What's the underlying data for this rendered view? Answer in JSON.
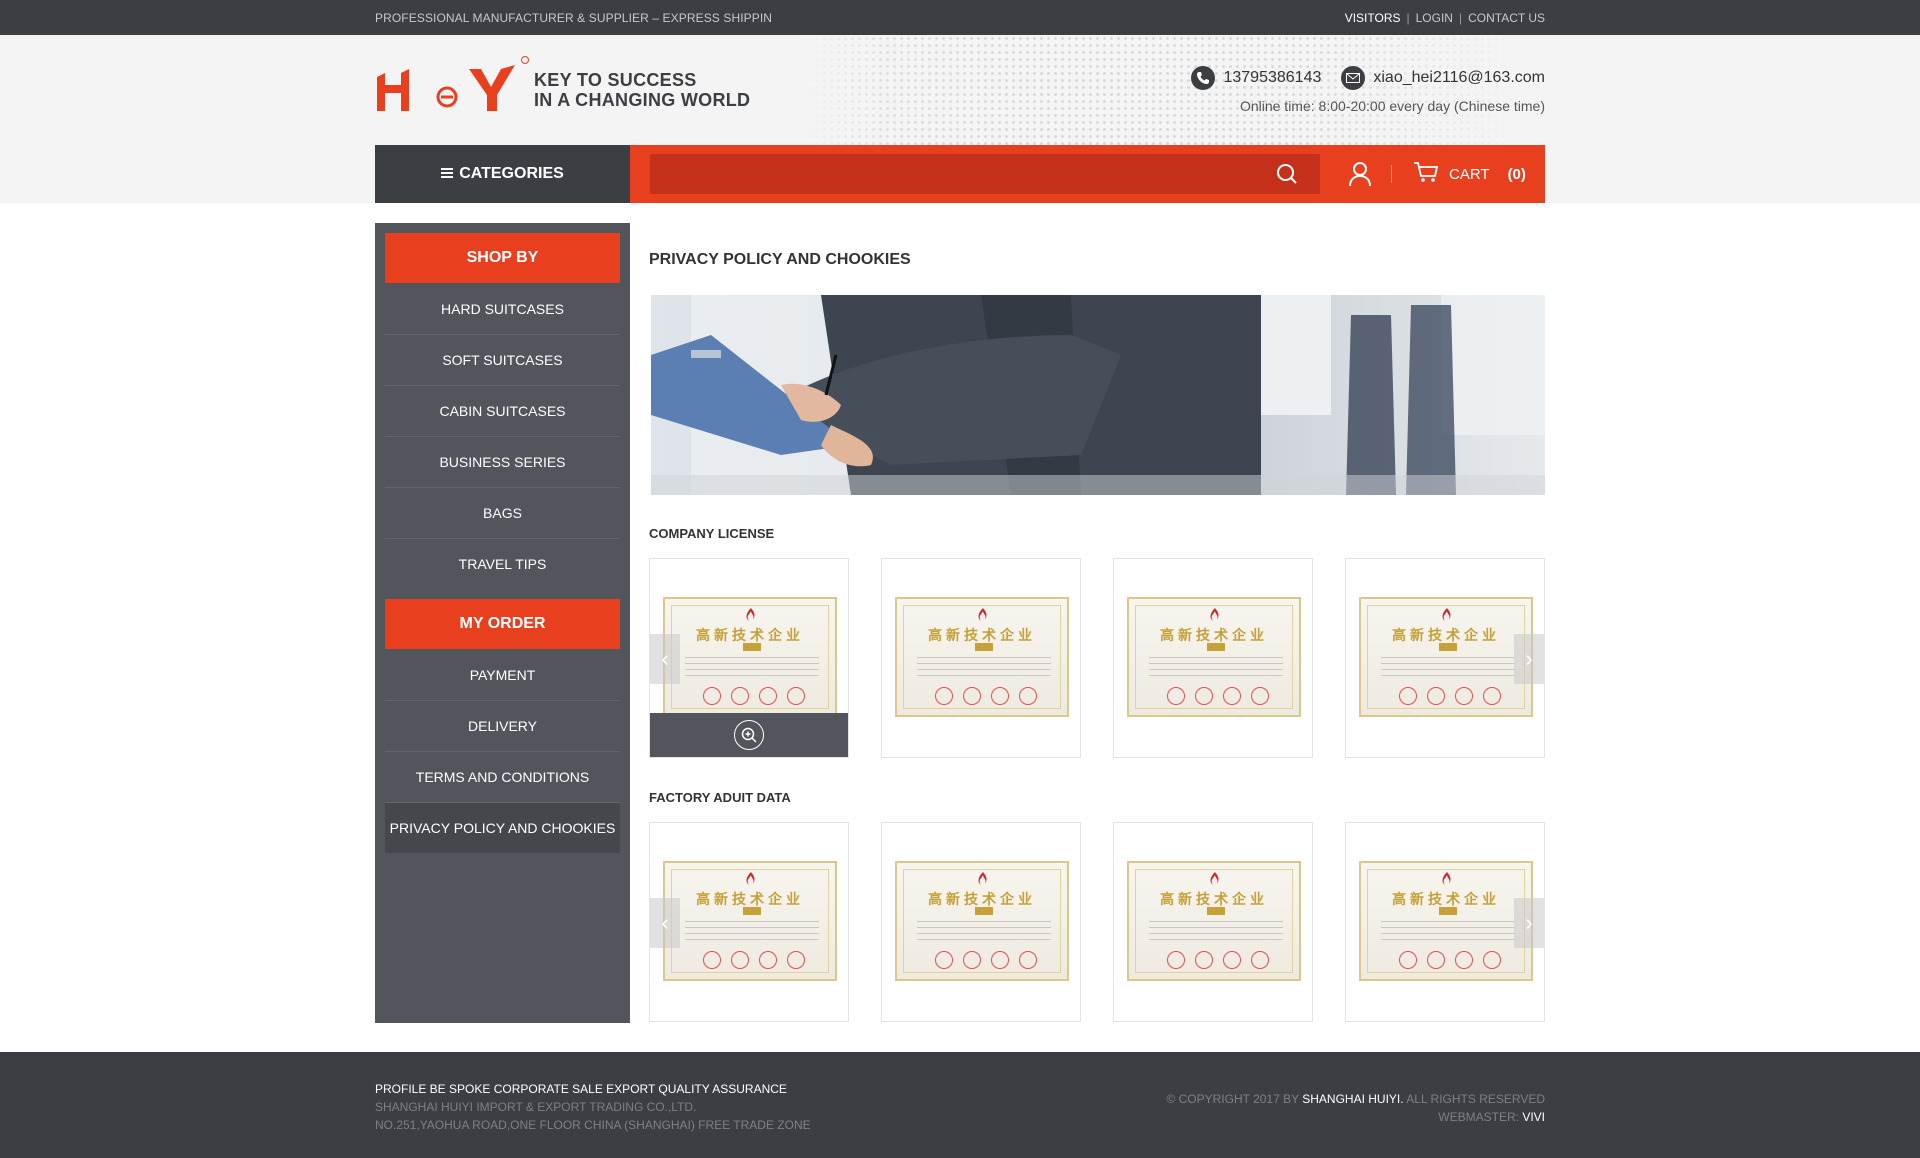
{
  "topbar": {
    "tagline": "PROFESSIONAL MANUFACTURER & SUPPLIER – EXPRESS SHIPPIN",
    "links": [
      "VISITORS",
      "LOGIN",
      "CONTACT US"
    ],
    "separator": "|"
  },
  "header": {
    "logo_alt": "H&Y",
    "slogan_line1": "KEY TO SUCCESS",
    "slogan_line2": "IN A CHANGING WORLD",
    "phone": "13795386143",
    "email": "xiao_hei2116@163.com",
    "online_time": "Online time: 8:00-20:00 every day (Chinese time)"
  },
  "nav": {
    "categories_label": "CATEGORIES",
    "search_placeholder": "",
    "cart_label": "CART",
    "cart_count": "(0)"
  },
  "sidebar": {
    "shop_by": "SHOP BY",
    "shop_items": [
      "HARD SUITCASES",
      "SOFT SUITCASES",
      "CABIN SUITCASES",
      "BUSINESS SERIES",
      "BAGS",
      "TRAVEL TIPS"
    ],
    "my_order": "MY ORDER",
    "order_items": [
      "PAYMENT",
      "DELIVERY",
      "TERMS AND CONDITIONS",
      "PRIVACY POLICY AND CHOOKIES"
    ]
  },
  "main": {
    "page_title": "PRIVACY POLICY AND CHOOKIES",
    "section1_title": "COMPANY LICENSE",
    "section2_title": "FACTORY ADUIT DATA",
    "certificate_text": "高新技术企业"
  },
  "footer": {
    "links_line": "PROFILE BE SPOKE CORPORATE SALE EXPORT QUALITY ASSURANCE",
    "company": "SHANGHAI HUIYI IMPORT & EXPORT  TRADING CO.,LTD.",
    "address": "NO.251,YAOHUA ROAD,ONE FLOOR  CHINA (SHANGHAI) FREE TRADE ZONE",
    "copyright_prefix": "© COPYRIGHT 2017 BY",
    "copyright_name": "SHANGHAI HUIYI.",
    "copyright_suffix": "ALL RIGHTS RESERVED",
    "webmaster_label": "WEBMASTER:",
    "webmaster_name": "VIVI"
  },
  "colors": {
    "accent": "#e8401f",
    "dark": "#3b3e43",
    "sidebar": "#52565c"
  }
}
